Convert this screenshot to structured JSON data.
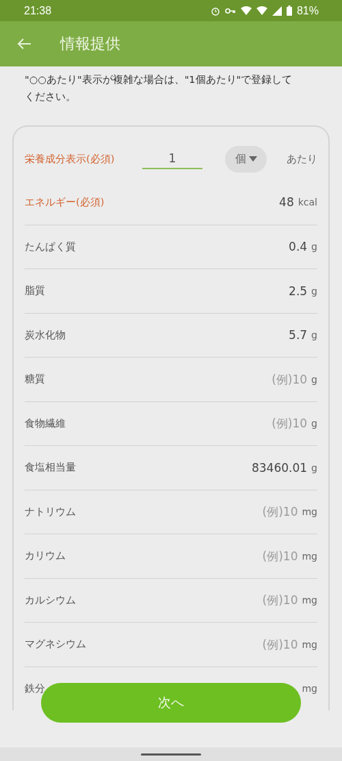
{
  "status_bar": {
    "time": "21:38",
    "battery": "81%"
  },
  "header": {
    "title": "情報提供"
  },
  "intro": "\"○○あたり\"表示が複雑な場合は、\"1個あたり\"で登録してください。",
  "serving": {
    "label": "栄養成分表示(必須)",
    "amount": "1",
    "unit": "個",
    "suffix": "あたり"
  },
  "rows": [
    {
      "label": "エネルギー(必須)",
      "required": true,
      "value": "48",
      "unit": "kcal"
    },
    {
      "label": "たんぱく質",
      "required": false,
      "value": "0.4",
      "unit": "g"
    },
    {
      "label": "脂質",
      "required": false,
      "value": "2.5",
      "unit": "g"
    },
    {
      "label": "炭水化物",
      "required": false,
      "value": "5.7",
      "unit": "g"
    },
    {
      "label": "糖質",
      "required": false,
      "placeholder": "(例)10",
      "unit": "g"
    },
    {
      "label": "食物繊維",
      "required": false,
      "placeholder": "(例)10",
      "unit": "g"
    },
    {
      "label": "食塩相当量",
      "required": false,
      "value": "83460.01",
      "unit": "g"
    },
    {
      "label": "ナトリウム",
      "required": false,
      "placeholder": "(例)10",
      "unit": "mg"
    },
    {
      "label": "カリウム",
      "required": false,
      "placeholder": "(例)10",
      "unit": "mg"
    },
    {
      "label": "カルシウム",
      "required": false,
      "placeholder": "(例)10",
      "unit": "mg"
    },
    {
      "label": "マグネシウム",
      "required": false,
      "placeholder": "(例)10",
      "unit": "mg"
    },
    {
      "label": "鉄分",
      "required": false,
      "unit": "mg"
    }
  ],
  "next_button": "次へ"
}
